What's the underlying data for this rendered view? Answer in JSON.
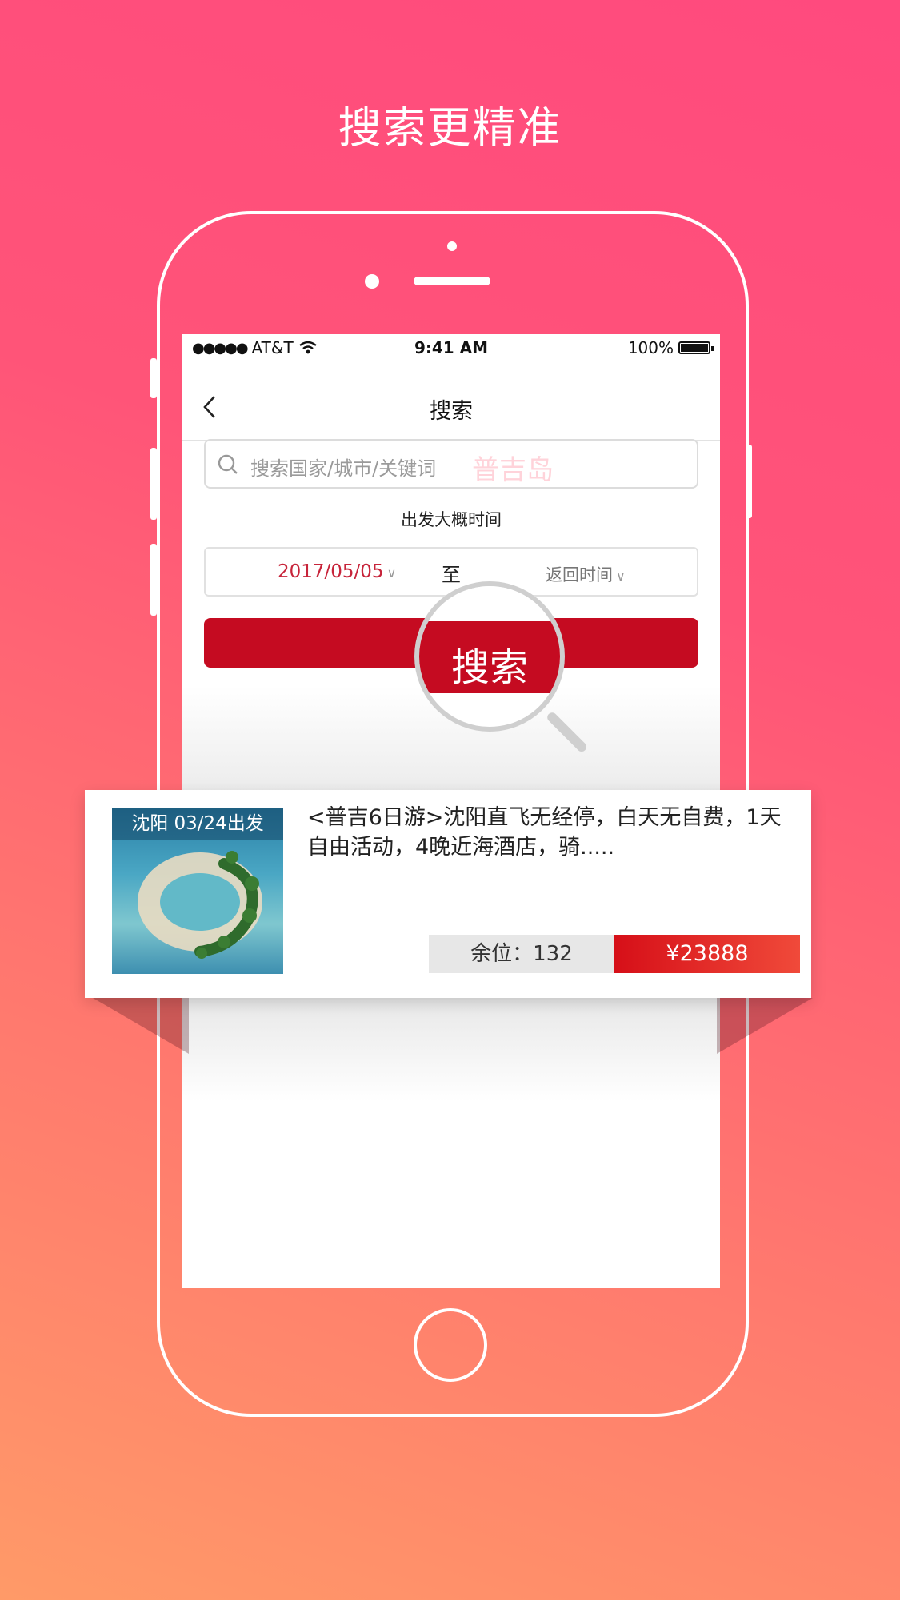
{
  "headline": "搜索更精准",
  "status_bar": {
    "carrier": "AT&T",
    "signal_dots": "●●●●●",
    "time": "9:41 AM",
    "battery": "100%"
  },
  "nav": {
    "title": "搜索"
  },
  "search": {
    "placeholder": "搜索国家/城市/关键词",
    "hint": "普吉岛"
  },
  "departure": {
    "label": "出发大概时间",
    "start_date": "2017/05/05",
    "separator": "至",
    "return_placeholder": "返回时间"
  },
  "search_button": {
    "label": "搜索"
  },
  "result": {
    "thumb_label": "沈阳 03/24出发",
    "title": "<普吉6日游>沈阳直飞无经停，白天无自费，1天自由活动，4晚近海酒店，骑.....",
    "seats": "余位：132",
    "price": "¥23888"
  },
  "colors": {
    "accent": "#c50b21",
    "price": "#e4261f",
    "hint": "#ffd3da"
  }
}
